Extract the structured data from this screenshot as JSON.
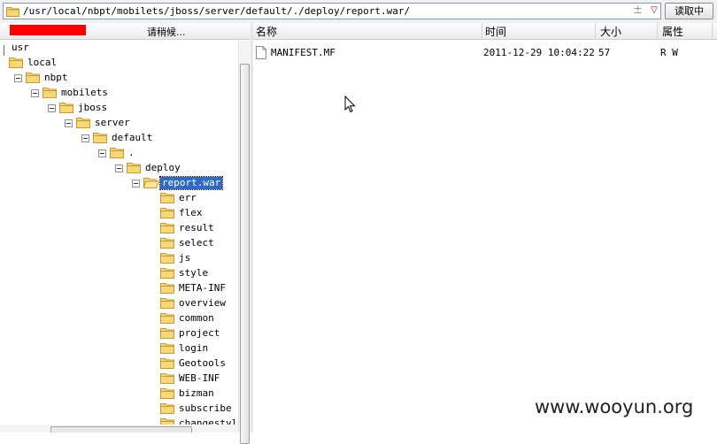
{
  "address_bar": {
    "path": "/usr/local/nbpt/mobilets/jboss/server/default/./deploy/report.war/",
    "plus_glyph": "±",
    "dropdown_glyph": "▽",
    "read_button_label": "读取中"
  },
  "tree_panel": {
    "loading_text": "请稍候...",
    "nodes": [
      {
        "label": "usr",
        "depth": 0,
        "expander": false,
        "folder": false
      },
      {
        "label": "local",
        "depth": 0,
        "expander": false,
        "folder": true
      },
      {
        "label": "nbpt",
        "depth": 1,
        "expander": true,
        "folder": true
      },
      {
        "label": "mobilets",
        "depth": 2,
        "expander": true,
        "folder": true
      },
      {
        "label": "jboss",
        "depth": 3,
        "expander": true,
        "folder": true
      },
      {
        "label": "server",
        "depth": 4,
        "expander": true,
        "folder": true
      },
      {
        "label": "default",
        "depth": 5,
        "expander": true,
        "folder": true
      },
      {
        "label": ".",
        "depth": 6,
        "expander": true,
        "folder": true
      },
      {
        "label": "deploy",
        "depth": 7,
        "expander": true,
        "folder": true
      },
      {
        "label": "report.war",
        "depth": 8,
        "expander": true,
        "folder": true,
        "selected": true
      },
      {
        "label": "err",
        "depth": 9,
        "expander": false,
        "folder": true
      },
      {
        "label": "flex",
        "depth": 9,
        "expander": false,
        "folder": true
      },
      {
        "label": "result",
        "depth": 9,
        "expander": false,
        "folder": true
      },
      {
        "label": "select",
        "depth": 9,
        "expander": false,
        "folder": true
      },
      {
        "label": "js",
        "depth": 9,
        "expander": false,
        "folder": true
      },
      {
        "label": "style",
        "depth": 9,
        "expander": false,
        "folder": true
      },
      {
        "label": "META-INF",
        "depth": 9,
        "expander": false,
        "folder": true
      },
      {
        "label": "overview",
        "depth": 9,
        "expander": false,
        "folder": true
      },
      {
        "label": "common",
        "depth": 9,
        "expander": false,
        "folder": true
      },
      {
        "label": "project",
        "depth": 9,
        "expander": false,
        "folder": true
      },
      {
        "label": "login",
        "depth": 9,
        "expander": false,
        "folder": true
      },
      {
        "label": "Geotools",
        "depth": 9,
        "expander": false,
        "folder": true
      },
      {
        "label": "WEB-INF",
        "depth": 9,
        "expander": false,
        "folder": true
      },
      {
        "label": "bizman",
        "depth": 9,
        "expander": false,
        "folder": true
      },
      {
        "label": "subscribe",
        "depth": 9,
        "expander": false,
        "folder": true
      },
      {
        "label": "changestyle",
        "depth": 9,
        "expander": false,
        "folder": true
      }
    ]
  },
  "file_list": {
    "columns": {
      "name": "名称",
      "time": "时间",
      "size": "大小",
      "attr": "属性"
    },
    "rows": [
      {
        "name": "MANIFEST.MF",
        "time": "2011-12-29 10:04:22",
        "size": "57",
        "attr": "R W",
        "icon": "file-icon"
      }
    ]
  },
  "watermark": "www.wooyun.org",
  "colors": {
    "selection": "#316ac5",
    "redaction": "#ff0000",
    "folder_fill": "#f8d776",
    "folder_stroke": "#c49a2c"
  }
}
